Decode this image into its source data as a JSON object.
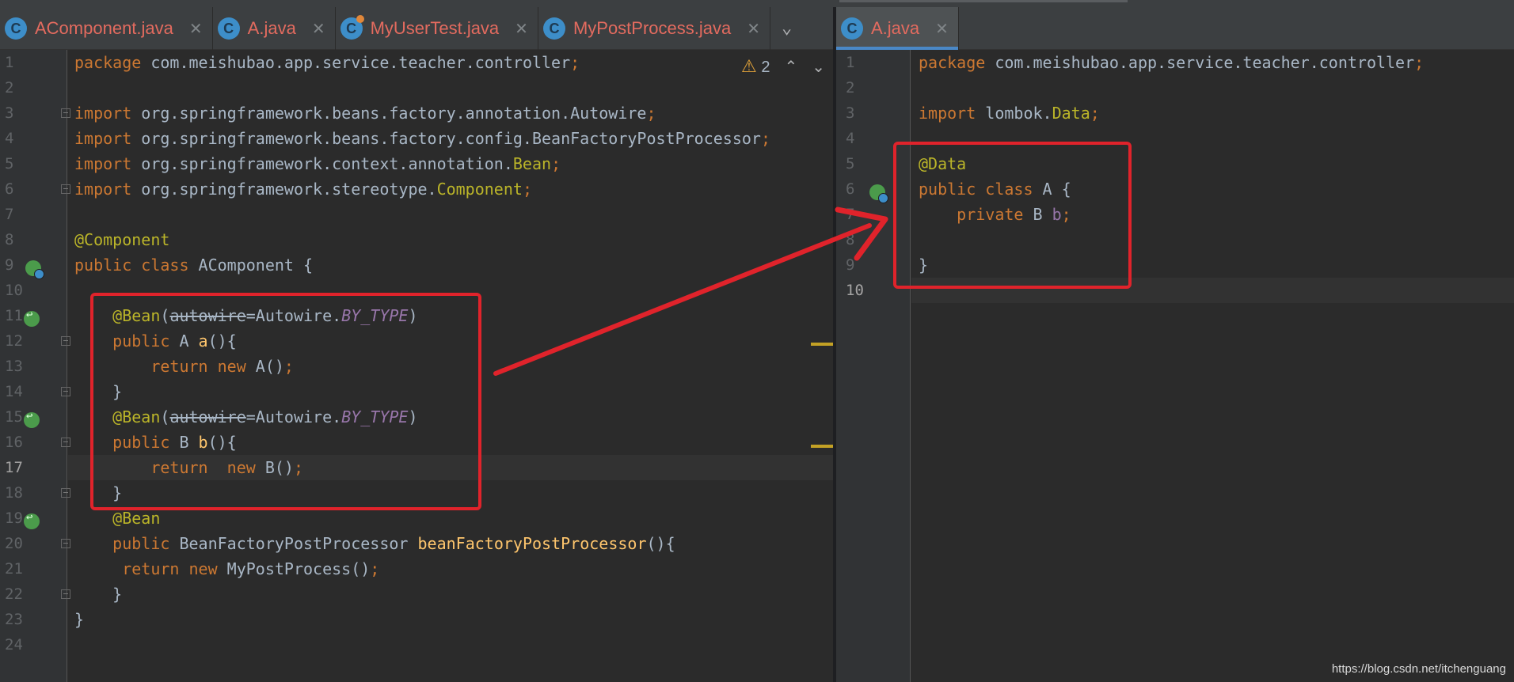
{
  "left_tabs": [
    {
      "label": "AComponent.java",
      "icon": "class-icon",
      "icon_letter": "C",
      "active": false
    },
    {
      "label": "A.java",
      "icon": "class-icon",
      "icon_letter": "C",
      "active": false
    },
    {
      "label": "MyUserTest.java",
      "icon": "test-class-icon",
      "icon_letter": "C",
      "active": false
    },
    {
      "label": "MyPostProcess.java",
      "icon": "class-icon",
      "icon_letter": "C",
      "active": false
    }
  ],
  "right_tabs": [
    {
      "label": "A.java",
      "icon": "class-icon",
      "icon_letter": "C",
      "active": true
    }
  ],
  "close_glyph": "✕",
  "tab_overflow_glyph": "⌄",
  "inspection": {
    "warning_glyph": "⚠",
    "count": "2",
    "prev_glyph": "⌃",
    "next_glyph": "⌄"
  },
  "left_lines": [
    "1",
    "2",
    "3",
    "4",
    "5",
    "6",
    "7",
    "8",
    "9",
    "10",
    "11",
    "12",
    "13",
    "14",
    "15",
    "16",
    "17",
    "18",
    "19",
    "20",
    "21",
    "22",
    "23",
    "24"
  ],
  "right_lines": [
    "1",
    "2",
    "3",
    "4",
    "5",
    "6",
    "7",
    "8",
    "9",
    "10"
  ],
  "left_code": {
    "l1_kw": "package",
    "l1_rest": " com.meishubao.app.service.teacher.controller",
    "l1_semi": ";",
    "l3_kw": "import",
    "l3_rest": " org.springframework.beans.factory.annotation.Autowire",
    "l3_semi": ";",
    "l4_kw": "import",
    "l4_rest": " org.springframework.beans.factory.config.BeanFactoryPostProcessor",
    "l4_semi": ";",
    "l5_kw": "import",
    "l5_rest": " org.springframework.context.annotation.",
    "l5_cls": "Bean",
    "l5_semi": ";",
    "l6_kw": "import",
    "l6_rest": " org.springframework.stereotype.",
    "l6_cls": "Component",
    "l6_semi": ";",
    "l8_ann": "@Component",
    "l9_kw": "public class",
    "l9_rest": " AComponent {",
    "l11_ann": "@Bean",
    "l11_p1": "(",
    "l11_strike": "autowire",
    "l11_p2": "=Autowire.",
    "l11_cst": "BY_TYPE",
    "l11_p3": ")",
    "l12_kw": "public",
    "l12_p1": " A ",
    "l12_fn": "a",
    "l12_p2": "(){",
    "l13_kw": "return new",
    "l13_p1": " A()",
    "l13_semi": ";",
    "l14": "}",
    "l15_ann": "@Bean",
    "l15_p1": "(",
    "l15_strike": "autowire",
    "l15_p2": "=Autowire.",
    "l15_cst": "BY_TYPE",
    "l15_p3": ")",
    "l16_kw": "public",
    "l16_p1": " B ",
    "l16_fn": "b",
    "l16_p2": "(){",
    "l17_kw1": "return",
    "l17_gap": "  ",
    "l17_kw2": "new",
    "l17_p1": " B()",
    "l17_semi": ";",
    "l18": "}",
    "l19_ann": "@Bean",
    "l20_kw": "public",
    "l20_p1": " BeanFactoryPostProcessor ",
    "l20_fn": "beanFactoryPostProcessor",
    "l20_p2": "(){",
    "l21_kw": "return new",
    "l21_p1": " MyPostProcess()",
    "l21_semi": ";",
    "l22": "}",
    "l23": "}"
  },
  "right_code": {
    "l1_kw": "package",
    "l1_rest": " com.meishubao.app.service.teacher.controller",
    "l1_semi": ";",
    "l3_kw": "import",
    "l3_rest": " lombok.",
    "l3_cls": "Data",
    "l3_semi": ";",
    "l5_ann": "@Data",
    "l6_kw": "public class",
    "l6_rest": " A {",
    "l7_kw": "private",
    "l7_p1": " B ",
    "l7_fld": "b",
    "l7_semi": ";",
    "l9": "}"
  },
  "watermark": "https://blog.csdn.net/itchenguang",
  "colors": {
    "background": "#2b2b2b",
    "keyword": "#cc7832",
    "annotation": "#bbb529",
    "method": "#ffc66d",
    "constant": "#9876aa",
    "tab_error_text": "#e36b5f",
    "highlight_red": "#e0232b",
    "active_tab_underline": "#4a88c7"
  }
}
